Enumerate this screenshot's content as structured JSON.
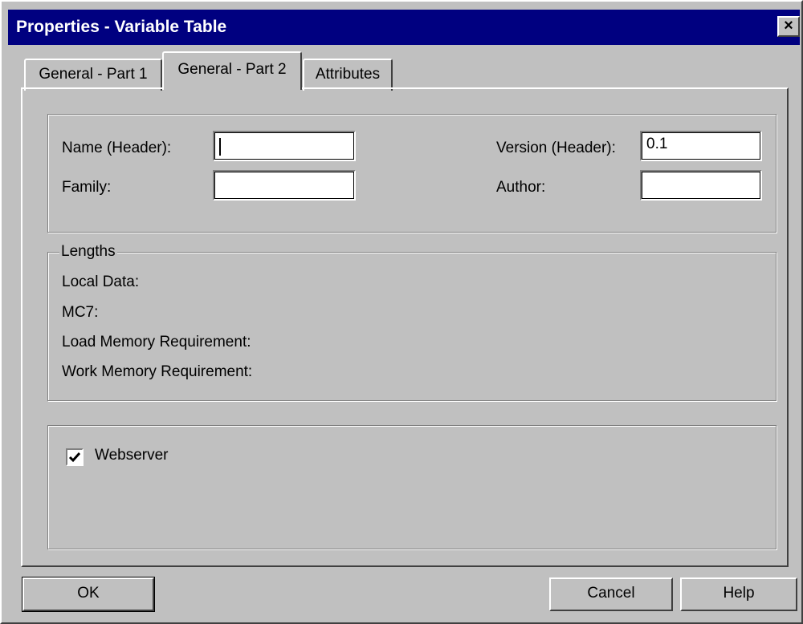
{
  "window": {
    "title": "Properties - Variable Table",
    "close_glyph": "×"
  },
  "tabs": [
    {
      "label": "General - Part 1",
      "active": false
    },
    {
      "label": "General - Part 2",
      "active": true
    },
    {
      "label": "Attributes",
      "active": false
    }
  ],
  "header": {
    "name_label": "Name (Header):",
    "name_value": "",
    "family_label": "Family:",
    "family_value": "",
    "version_label": "Version (Header):",
    "version_value": "0.1",
    "author_label": "Author:",
    "author_value": ""
  },
  "lengths": {
    "legend": "Lengths",
    "local_data": "Local Data:",
    "mc7": "MC7:",
    "load_memory": "Load Memory Requirement:",
    "work_memory": "Work Memory Requirement:"
  },
  "webserver": {
    "label": "Webserver",
    "checked": true
  },
  "buttons": {
    "ok": "OK",
    "cancel": "Cancel",
    "help": "Help"
  },
  "icons": [
    "close-icon",
    "checkmark-icon"
  ]
}
